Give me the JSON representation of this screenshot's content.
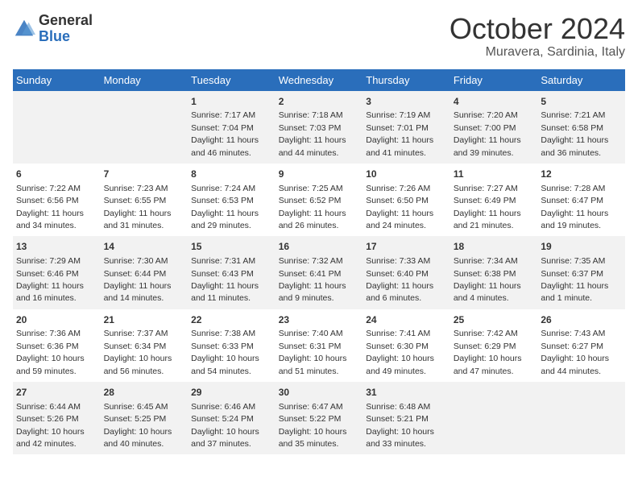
{
  "header": {
    "logo_general": "General",
    "logo_blue": "Blue",
    "month_title": "October 2024",
    "location": "Muravera, Sardinia, Italy"
  },
  "days_of_week": [
    "Sunday",
    "Monday",
    "Tuesday",
    "Wednesday",
    "Thursday",
    "Friday",
    "Saturday"
  ],
  "weeks": [
    [
      null,
      null,
      {
        "day": "1",
        "sunrise": "Sunrise: 7:17 AM",
        "sunset": "Sunset: 7:04 PM",
        "daylight": "Daylight: 11 hours and 46 minutes."
      },
      {
        "day": "2",
        "sunrise": "Sunrise: 7:18 AM",
        "sunset": "Sunset: 7:03 PM",
        "daylight": "Daylight: 11 hours and 44 minutes."
      },
      {
        "day": "3",
        "sunrise": "Sunrise: 7:19 AM",
        "sunset": "Sunset: 7:01 PM",
        "daylight": "Daylight: 11 hours and 41 minutes."
      },
      {
        "day": "4",
        "sunrise": "Sunrise: 7:20 AM",
        "sunset": "Sunset: 7:00 PM",
        "daylight": "Daylight: 11 hours and 39 minutes."
      },
      {
        "day": "5",
        "sunrise": "Sunrise: 7:21 AM",
        "sunset": "Sunset: 6:58 PM",
        "daylight": "Daylight: 11 hours and 36 minutes."
      }
    ],
    [
      {
        "day": "6",
        "sunrise": "Sunrise: 7:22 AM",
        "sunset": "Sunset: 6:56 PM",
        "daylight": "Daylight: 11 hours and 34 minutes."
      },
      {
        "day": "7",
        "sunrise": "Sunrise: 7:23 AM",
        "sunset": "Sunset: 6:55 PM",
        "daylight": "Daylight: 11 hours and 31 minutes."
      },
      {
        "day": "8",
        "sunrise": "Sunrise: 7:24 AM",
        "sunset": "Sunset: 6:53 PM",
        "daylight": "Daylight: 11 hours and 29 minutes."
      },
      {
        "day": "9",
        "sunrise": "Sunrise: 7:25 AM",
        "sunset": "Sunset: 6:52 PM",
        "daylight": "Daylight: 11 hours and 26 minutes."
      },
      {
        "day": "10",
        "sunrise": "Sunrise: 7:26 AM",
        "sunset": "Sunset: 6:50 PM",
        "daylight": "Daylight: 11 hours and 24 minutes."
      },
      {
        "day": "11",
        "sunrise": "Sunrise: 7:27 AM",
        "sunset": "Sunset: 6:49 PM",
        "daylight": "Daylight: 11 hours and 21 minutes."
      },
      {
        "day": "12",
        "sunrise": "Sunrise: 7:28 AM",
        "sunset": "Sunset: 6:47 PM",
        "daylight": "Daylight: 11 hours and 19 minutes."
      }
    ],
    [
      {
        "day": "13",
        "sunrise": "Sunrise: 7:29 AM",
        "sunset": "Sunset: 6:46 PM",
        "daylight": "Daylight: 11 hours and 16 minutes."
      },
      {
        "day": "14",
        "sunrise": "Sunrise: 7:30 AM",
        "sunset": "Sunset: 6:44 PM",
        "daylight": "Daylight: 11 hours and 14 minutes."
      },
      {
        "day": "15",
        "sunrise": "Sunrise: 7:31 AM",
        "sunset": "Sunset: 6:43 PM",
        "daylight": "Daylight: 11 hours and 11 minutes."
      },
      {
        "day": "16",
        "sunrise": "Sunrise: 7:32 AM",
        "sunset": "Sunset: 6:41 PM",
        "daylight": "Daylight: 11 hours and 9 minutes."
      },
      {
        "day": "17",
        "sunrise": "Sunrise: 7:33 AM",
        "sunset": "Sunset: 6:40 PM",
        "daylight": "Daylight: 11 hours and 6 minutes."
      },
      {
        "day": "18",
        "sunrise": "Sunrise: 7:34 AM",
        "sunset": "Sunset: 6:38 PM",
        "daylight": "Daylight: 11 hours and 4 minutes."
      },
      {
        "day": "19",
        "sunrise": "Sunrise: 7:35 AM",
        "sunset": "Sunset: 6:37 PM",
        "daylight": "Daylight: 11 hours and 1 minute."
      }
    ],
    [
      {
        "day": "20",
        "sunrise": "Sunrise: 7:36 AM",
        "sunset": "Sunset: 6:36 PM",
        "daylight": "Daylight: 10 hours and 59 minutes."
      },
      {
        "day": "21",
        "sunrise": "Sunrise: 7:37 AM",
        "sunset": "Sunset: 6:34 PM",
        "daylight": "Daylight: 10 hours and 56 minutes."
      },
      {
        "day": "22",
        "sunrise": "Sunrise: 7:38 AM",
        "sunset": "Sunset: 6:33 PM",
        "daylight": "Daylight: 10 hours and 54 minutes."
      },
      {
        "day": "23",
        "sunrise": "Sunrise: 7:40 AM",
        "sunset": "Sunset: 6:31 PM",
        "daylight": "Daylight: 10 hours and 51 minutes."
      },
      {
        "day": "24",
        "sunrise": "Sunrise: 7:41 AM",
        "sunset": "Sunset: 6:30 PM",
        "daylight": "Daylight: 10 hours and 49 minutes."
      },
      {
        "day": "25",
        "sunrise": "Sunrise: 7:42 AM",
        "sunset": "Sunset: 6:29 PM",
        "daylight": "Daylight: 10 hours and 47 minutes."
      },
      {
        "day": "26",
        "sunrise": "Sunrise: 7:43 AM",
        "sunset": "Sunset: 6:27 PM",
        "daylight": "Daylight: 10 hours and 44 minutes."
      }
    ],
    [
      {
        "day": "27",
        "sunrise": "Sunrise: 6:44 AM",
        "sunset": "Sunset: 5:26 PM",
        "daylight": "Daylight: 10 hours and 42 minutes."
      },
      {
        "day": "28",
        "sunrise": "Sunrise: 6:45 AM",
        "sunset": "Sunset: 5:25 PM",
        "daylight": "Daylight: 10 hours and 40 minutes."
      },
      {
        "day": "29",
        "sunrise": "Sunrise: 6:46 AM",
        "sunset": "Sunset: 5:24 PM",
        "daylight": "Daylight: 10 hours and 37 minutes."
      },
      {
        "day": "30",
        "sunrise": "Sunrise: 6:47 AM",
        "sunset": "Sunset: 5:22 PM",
        "daylight": "Daylight: 10 hours and 35 minutes."
      },
      {
        "day": "31",
        "sunrise": "Sunrise: 6:48 AM",
        "sunset": "Sunset: 5:21 PM",
        "daylight": "Daylight: 10 hours and 33 minutes."
      },
      null,
      null
    ]
  ]
}
